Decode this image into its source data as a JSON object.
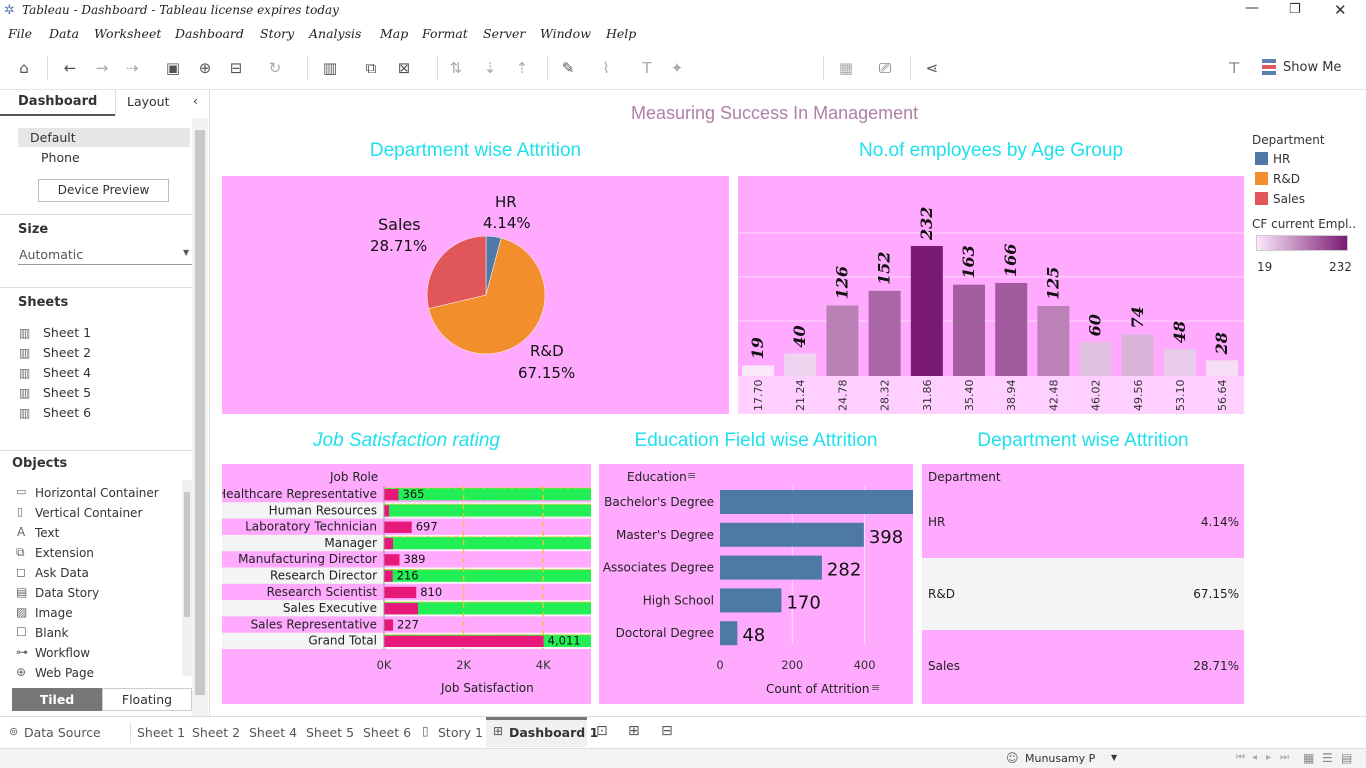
{
  "window": {
    "title": "Tableau - Dashboard - Tableau license expires today"
  },
  "menu": [
    "File",
    "Data",
    "Worksheet",
    "Dashboard",
    "Story",
    "Analysis",
    "Map",
    "Format",
    "Server",
    "Window",
    "Help"
  ],
  "toolbar": {
    "show_me": "Show Me"
  },
  "left_pane": {
    "tabs": [
      "Dashboard",
      "Layout"
    ],
    "device": {
      "default": "Default",
      "phone": "Phone",
      "preview_button": "Device Preview"
    },
    "size": {
      "heading": "Size",
      "value": "Automatic"
    },
    "sheets": {
      "heading": "Sheets",
      "items": [
        "Sheet 1",
        "Sheet 2",
        "Sheet 4",
        "Sheet 5",
        "Sheet 6"
      ]
    },
    "objects": {
      "heading": "Objects",
      "items": [
        "Horizontal Container",
        "Vertical Container",
        "Text",
        "Extension",
        "Ask Data",
        "Data Story",
        "Image",
        "Blank",
        "Workflow",
        "Web Page"
      ]
    },
    "layout_toggle": {
      "tiled": "Tiled",
      "floating": "Floating"
    }
  },
  "dashboard": {
    "title": "Measuring Success In Management",
    "legend": {
      "heading": "Department",
      "items": [
        {
          "label": "HR",
          "color": "#4e79a7"
        },
        {
          "label": "R&D",
          "color": "#f28e2b"
        },
        {
          "label": "Sales",
          "color": "#e15759"
        }
      ],
      "cf_heading": "CF current Empl..",
      "cf_min": "19",
      "cf_max": "232"
    }
  },
  "chart_data": [
    {
      "type": "pie",
      "title": "Department wise Attrition",
      "labels": [
        "HR",
        "R&D",
        "Sales"
      ],
      "values": [
        4.14,
        67.15,
        28.71
      ],
      "display": [
        "4.14%",
        "67.15%",
        "28.71%"
      ],
      "colors": [
        "#4e79a7",
        "#f28e2b",
        "#e15759"
      ]
    },
    {
      "type": "bar",
      "title": "No.of employees by Age Group",
      "categories": [
        "17.70",
        "21.24",
        "24.78",
        "28.32",
        "31.86",
        "35.40",
        "38.94",
        "42.48",
        "46.02",
        "49.56",
        "53.10",
        "56.64"
      ],
      "values": [
        19,
        40,
        126,
        152,
        232,
        163,
        166,
        125,
        60,
        74,
        48,
        28
      ],
      "ylim": [
        0,
        232
      ]
    },
    {
      "type": "bar",
      "title": "Job Satisfaction rating",
      "row_header": "Job Role",
      "xlabel": "Job Satisfaction",
      "categories": [
        "Healthcare Representative",
        "Human Resources",
        "Laboratory Technician",
        "Manager",
        "Manufacturing Director",
        "Research Director",
        "Research Scientist",
        "Sales Executive",
        "Sales Representative",
        "Grand Total"
      ],
      "values": [
        365,
        0,
        697,
        0,
        389,
        216,
        810,
        0,
        227,
        4011
      ],
      "display": [
        "365",
        "",
        "697",
        "",
        "389",
        "216",
        "810",
        "",
        "227",
        "4,011"
      ],
      "ticks": [
        "0K",
        "2K",
        "4K"
      ],
      "xlim": [
        0,
        5200
      ]
    },
    {
      "type": "bar",
      "title": "Education Field wise Attrition",
      "row_header": "Education",
      "xlabel": "Count of Attrition",
      "categories": [
        "Bachelor's Degree",
        "Master's Degree",
        "Associates Degree",
        "High School",
        "Doctoral Degree"
      ],
      "values": [
        572,
        398,
        282,
        170,
        48
      ],
      "ticks": [
        "0",
        "200",
        "400",
        "600"
      ],
      "xlim": [
        0,
        700
      ]
    },
    {
      "type": "table",
      "title": "Department wise Attrition",
      "header": "Department",
      "rows": [
        {
          "label": "HR",
          "value": "4.14%"
        },
        {
          "label": "R&D",
          "value": "67.15%"
        },
        {
          "label": "Sales",
          "value": "28.71%"
        }
      ]
    }
  ],
  "bottom_tabs": [
    "Data Source",
    "Sheet 1",
    "Sheet 2",
    "Sheet 4",
    "Sheet 5",
    "Sheet 6",
    "Story 1",
    "Dashboard 1"
  ],
  "status": {
    "user": "Munusamy P"
  }
}
